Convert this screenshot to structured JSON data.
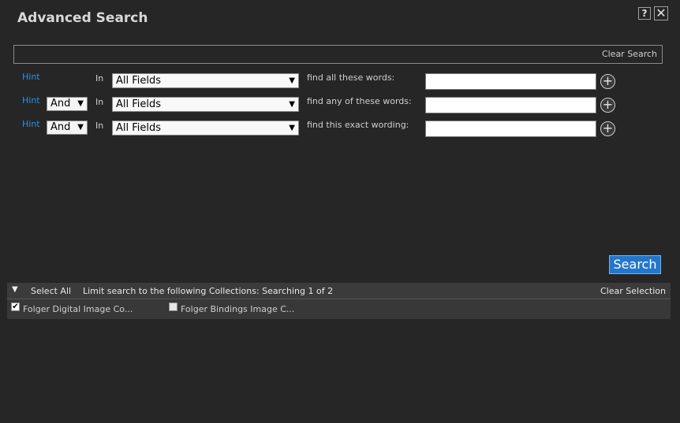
{
  "dialog": {
    "title": "Advanced Search",
    "help_label": "?",
    "close_label": "✕"
  },
  "search_bar": {
    "clear_label": "Clear Search"
  },
  "rows": [
    {
      "hint": "Hint",
      "operator": "",
      "in_label": "In",
      "field": "All Fields",
      "find_label": "find all these words:",
      "value": ""
    },
    {
      "hint": "Hint",
      "operator": "And",
      "in_label": "In",
      "field": "All Fields",
      "find_label": "find any of these words:",
      "value": ""
    },
    {
      "hint": "Hint",
      "operator": "And",
      "in_label": "In",
      "field": "All Fields",
      "find_label": "find this exact wording:",
      "value": ""
    }
  ],
  "search_button": "Search",
  "collections": {
    "toggle_icon": "▼",
    "select_all": "Select All",
    "limit_text": "Limit search to the following Collections: Searching 1 of 2",
    "clear_selection": "Clear Selection",
    "items": [
      {
        "label": "Folger Digital Image Co...",
        "checked": true
      },
      {
        "label": "Folger Bindings Image C...",
        "checked": false
      }
    ]
  }
}
